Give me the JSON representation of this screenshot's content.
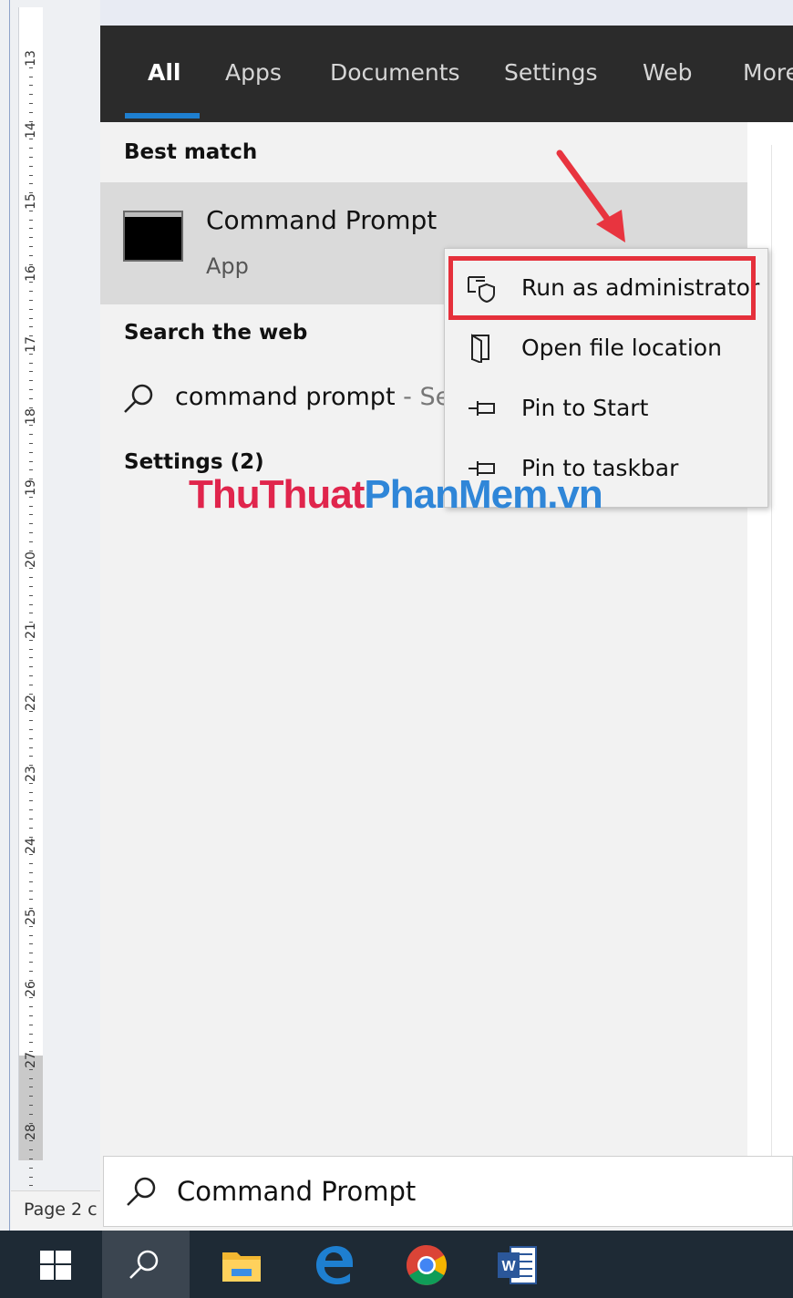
{
  "ruler": {
    "numbers": [
      "13",
      "14",
      "15",
      "16",
      "17",
      "18",
      "19",
      "20",
      "21",
      "22",
      "23",
      "24",
      "25",
      "26",
      "27",
      "28"
    ],
    "page_label": "Page 2 c"
  },
  "tabs": [
    {
      "label": "All",
      "active": true
    },
    {
      "label": "Apps"
    },
    {
      "label": "Documents"
    },
    {
      "label": "Settings"
    },
    {
      "label": "Web"
    },
    {
      "label": "More"
    }
  ],
  "best_match": {
    "heading": "Best match",
    "title": "Command Prompt",
    "subtitle": "App",
    "icon": "cmd-icon"
  },
  "search_web": {
    "heading": "Search the web",
    "query": "command prompt",
    "suffix": " - Se"
  },
  "settings_heading": "Settings (2)",
  "context_menu": [
    {
      "label": "Run as administrator",
      "icon": "shield-icon",
      "highlighted": true
    },
    {
      "label": "Open file location",
      "icon": "folder-open-icon"
    },
    {
      "label": "Pin to Start",
      "icon": "pin-icon"
    },
    {
      "label": "Pin to taskbar",
      "icon": "pin-icon"
    }
  ],
  "watermark": {
    "part1": "ThuThuat",
    "part2": "PhanMem.vn"
  },
  "searchbar": {
    "value": "Command Prompt"
  },
  "taskbar": [
    "windows-start-icon",
    "search-icon",
    "file-explorer-icon",
    "edge-icon",
    "chrome-icon",
    "word-icon"
  ],
  "colors": {
    "accent": "#1e7fd0",
    "highlight_border": "#e5303b",
    "tabbar": "#2b2b2b",
    "taskbar": "#1e2a35"
  }
}
